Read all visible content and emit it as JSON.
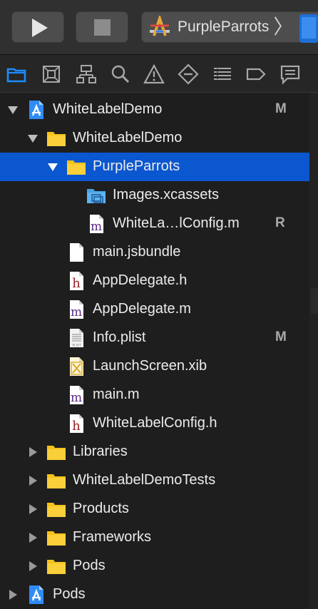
{
  "toolbar": {
    "scheme_name": "PurpleParrots",
    "scheme_separator": "〉"
  },
  "navigator_tabs": [
    {
      "icon": "folder-icon",
      "active": true
    },
    {
      "icon": "source-control-icon",
      "active": false
    },
    {
      "icon": "symbol-hierarchy-icon",
      "active": false
    },
    {
      "icon": "find-icon",
      "active": false
    },
    {
      "icon": "warning-icon",
      "active": false
    },
    {
      "icon": "test-diamond-icon",
      "active": false
    },
    {
      "icon": "debug-list-icon",
      "active": false
    },
    {
      "icon": "breakpoint-icon",
      "active": false
    },
    {
      "icon": "report-icon",
      "active": false
    }
  ],
  "tree": {
    "items": [
      {
        "label": "WhiteLabelDemo",
        "badge": "M",
        "icon": "xcode-project-icon",
        "disclosure": "open"
      },
      {
        "label": "WhiteLabelDemo",
        "badge": "",
        "icon": "folder-icon",
        "disclosure": "open"
      },
      {
        "label": "PurpleParrots",
        "badge": "",
        "icon": "folder-icon",
        "disclosure": "open",
        "selected": true
      },
      {
        "label": "Images.xcassets",
        "badge": "",
        "icon": "asset-catalog-icon",
        "disclosure": ""
      },
      {
        "label": "WhiteLa…lConfig.m",
        "badge": "R",
        "icon": "m-file-icon",
        "disclosure": ""
      },
      {
        "label": "main.jsbundle",
        "badge": "",
        "icon": "plain-file-icon",
        "disclosure": ""
      },
      {
        "label": "AppDelegate.h",
        "badge": "",
        "icon": "h-file-icon",
        "disclosure": ""
      },
      {
        "label": "AppDelegate.m",
        "badge": "",
        "icon": "m-file-icon",
        "disclosure": ""
      },
      {
        "label": "Info.plist",
        "badge": "M",
        "icon": "plist-file-icon",
        "disclosure": ""
      },
      {
        "label": "LaunchScreen.xib",
        "badge": "",
        "icon": "xib-file-icon",
        "disclosure": ""
      },
      {
        "label": "main.m",
        "badge": "",
        "icon": "m-file-icon",
        "disclosure": ""
      },
      {
        "label": "WhiteLabelConfig.h",
        "badge": "",
        "icon": "h-file-icon",
        "disclosure": ""
      },
      {
        "label": "Libraries",
        "badge": "",
        "icon": "folder-icon",
        "disclosure": "closed"
      },
      {
        "label": "WhiteLabelDemoTests",
        "badge": "",
        "icon": "folder-icon",
        "disclosure": "closed"
      },
      {
        "label": "Products",
        "badge": "",
        "icon": "folder-icon",
        "disclosure": "closed"
      },
      {
        "label": "Frameworks",
        "badge": "",
        "icon": "folder-icon",
        "disclosure": "closed"
      },
      {
        "label": "Pods",
        "badge": "",
        "icon": "folder-icon",
        "disclosure": "closed"
      },
      {
        "label": "Pods",
        "badge": "",
        "icon": "xcode-project-icon",
        "disclosure": "closed"
      }
    ]
  },
  "colors": {
    "selection": "#0b57d0",
    "folder": "#f5c21b",
    "navigator_active": "#1a8cff"
  }
}
